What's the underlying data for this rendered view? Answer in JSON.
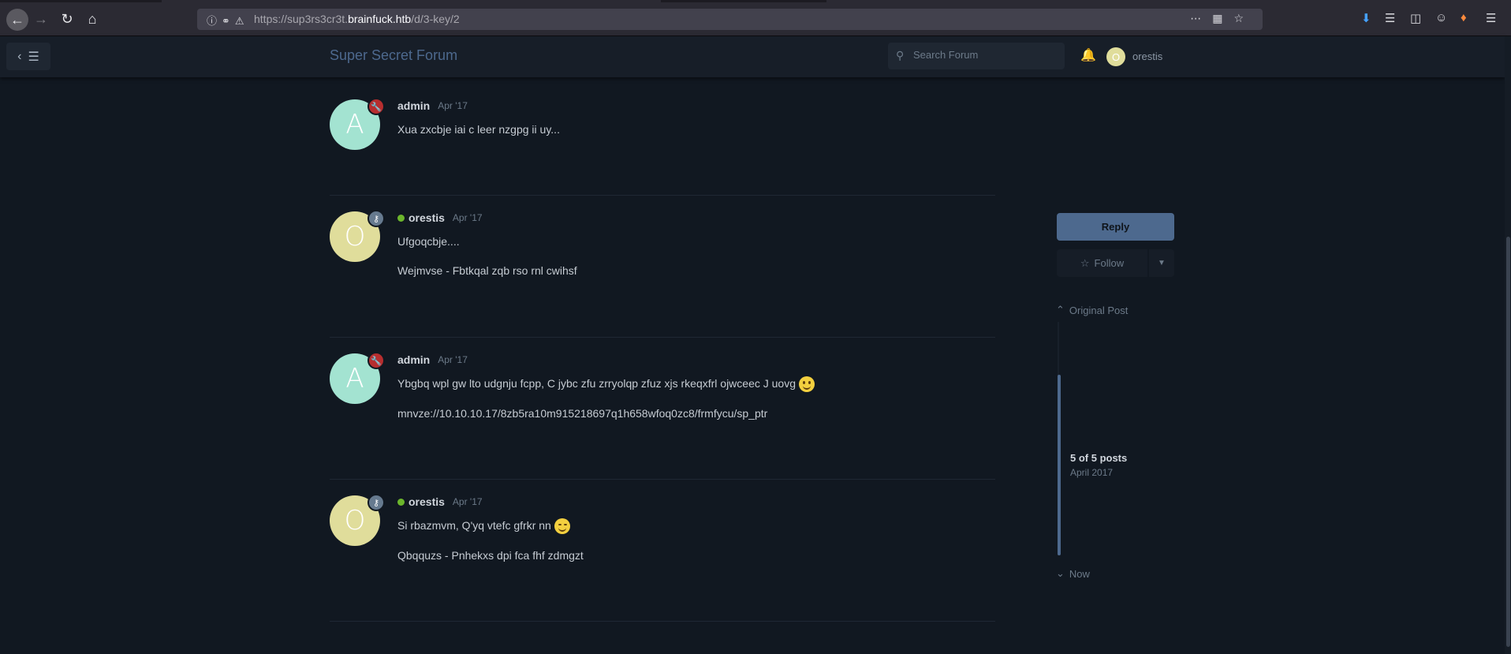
{
  "browser": {
    "url_prefix": "https://sup3rs3cr3t.",
    "url_domain": "brainfuck.htb",
    "url_path": "/d/3-key/2"
  },
  "header": {
    "forum_title": "Super Secret Forum",
    "search_placeholder": "Search Forum",
    "current_user": "orestis",
    "current_user_initial": "O"
  },
  "posts": [
    {
      "author": "admin",
      "initial": "A",
      "time": "Apr '17",
      "paragraphs": [
        "Xua zxcbje iai c leer nzgpg ii uy..."
      ]
    },
    {
      "author": "orestis",
      "initial": "O",
      "time": "Apr '17",
      "paragraphs": [
        "Ufgoqcbje....",
        "Wejmvse - Fbtkqal zqb rso rnl cwihsf"
      ]
    },
    {
      "author": "admin",
      "initial": "A",
      "time": "Apr '17",
      "paragraphs": [
        "Ybgbq wpl gw lto udgnju fcpp, C jybc zfu zrryolqp zfuz xjs rkeqxfrl ojwceec J uovg",
        "mnvze://10.10.10.17/8zb5ra10m915218697q1h658wfoq0zc8/frmfycu/sp_ptr"
      ]
    },
    {
      "author": "orestis",
      "initial": "O",
      "time": "Apr '17",
      "paragraphs": [
        "Si rbazmvm, Q'yq vtefc gfrkr nn",
        "Qbqquzs - Pnhekxs dpi fca fhf zdmgzt"
      ]
    }
  ],
  "sidebar": {
    "reply_label": "Reply",
    "follow_label": "Follow",
    "original_post_label": "Original Post",
    "post_count_label": "5 of 5 posts",
    "post_date_label": "April 2017",
    "now_label": "Now"
  },
  "colors": {
    "background": "#111821",
    "accent": "#4d698e",
    "admin_avatar": "#a3e3d1",
    "orestis_avatar": "#e0dd9b",
    "admin_badge": "#b72e2f",
    "online": "#6cb62c"
  }
}
